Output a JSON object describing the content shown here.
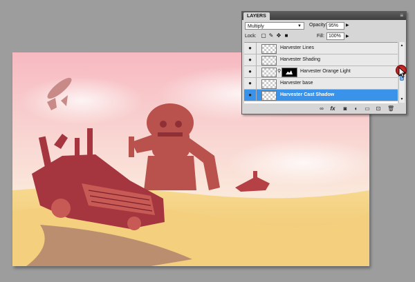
{
  "canvas": {
    "artwork": "harvester-desert-illustration"
  },
  "layers_panel": {
    "tab_label": "LAYERS",
    "menu_icon": "panel-menu-icon",
    "blend_mode": "Multiply",
    "opacity_label": "Opacity:",
    "opacity_value": "95%",
    "lock_label": "Lock:",
    "lock_icons": [
      "lock-transparent-icon",
      "lock-image-icon",
      "lock-position-icon",
      "lock-all-icon"
    ],
    "fill_label": "Fill:",
    "fill_value": "100%",
    "layers": [
      {
        "name": "Harvester Lines",
        "visible": true,
        "selected": false,
        "has_mask": false
      },
      {
        "name": "Harvester Shading",
        "visible": true,
        "selected": false,
        "has_mask": false
      },
      {
        "name": "Harvester Orange Light",
        "visible": true,
        "selected": false,
        "has_mask": true
      },
      {
        "name": "Harvester base",
        "visible": true,
        "selected": false,
        "has_mask": false
      },
      {
        "name": "Harvester Cast Shadow",
        "visible": true,
        "selected": true,
        "has_mask": false
      }
    ],
    "footer_icons": [
      "link-layers-icon",
      "fx-icon",
      "add-mask-icon",
      "adjustment-layer-icon",
      "new-group-icon",
      "new-layer-icon",
      "delete-layer-icon"
    ]
  },
  "colors": {
    "selection": "#3a93ea",
    "panel_bg": "#d6d6d6",
    "workspace_bg": "#9d9d9d"
  }
}
